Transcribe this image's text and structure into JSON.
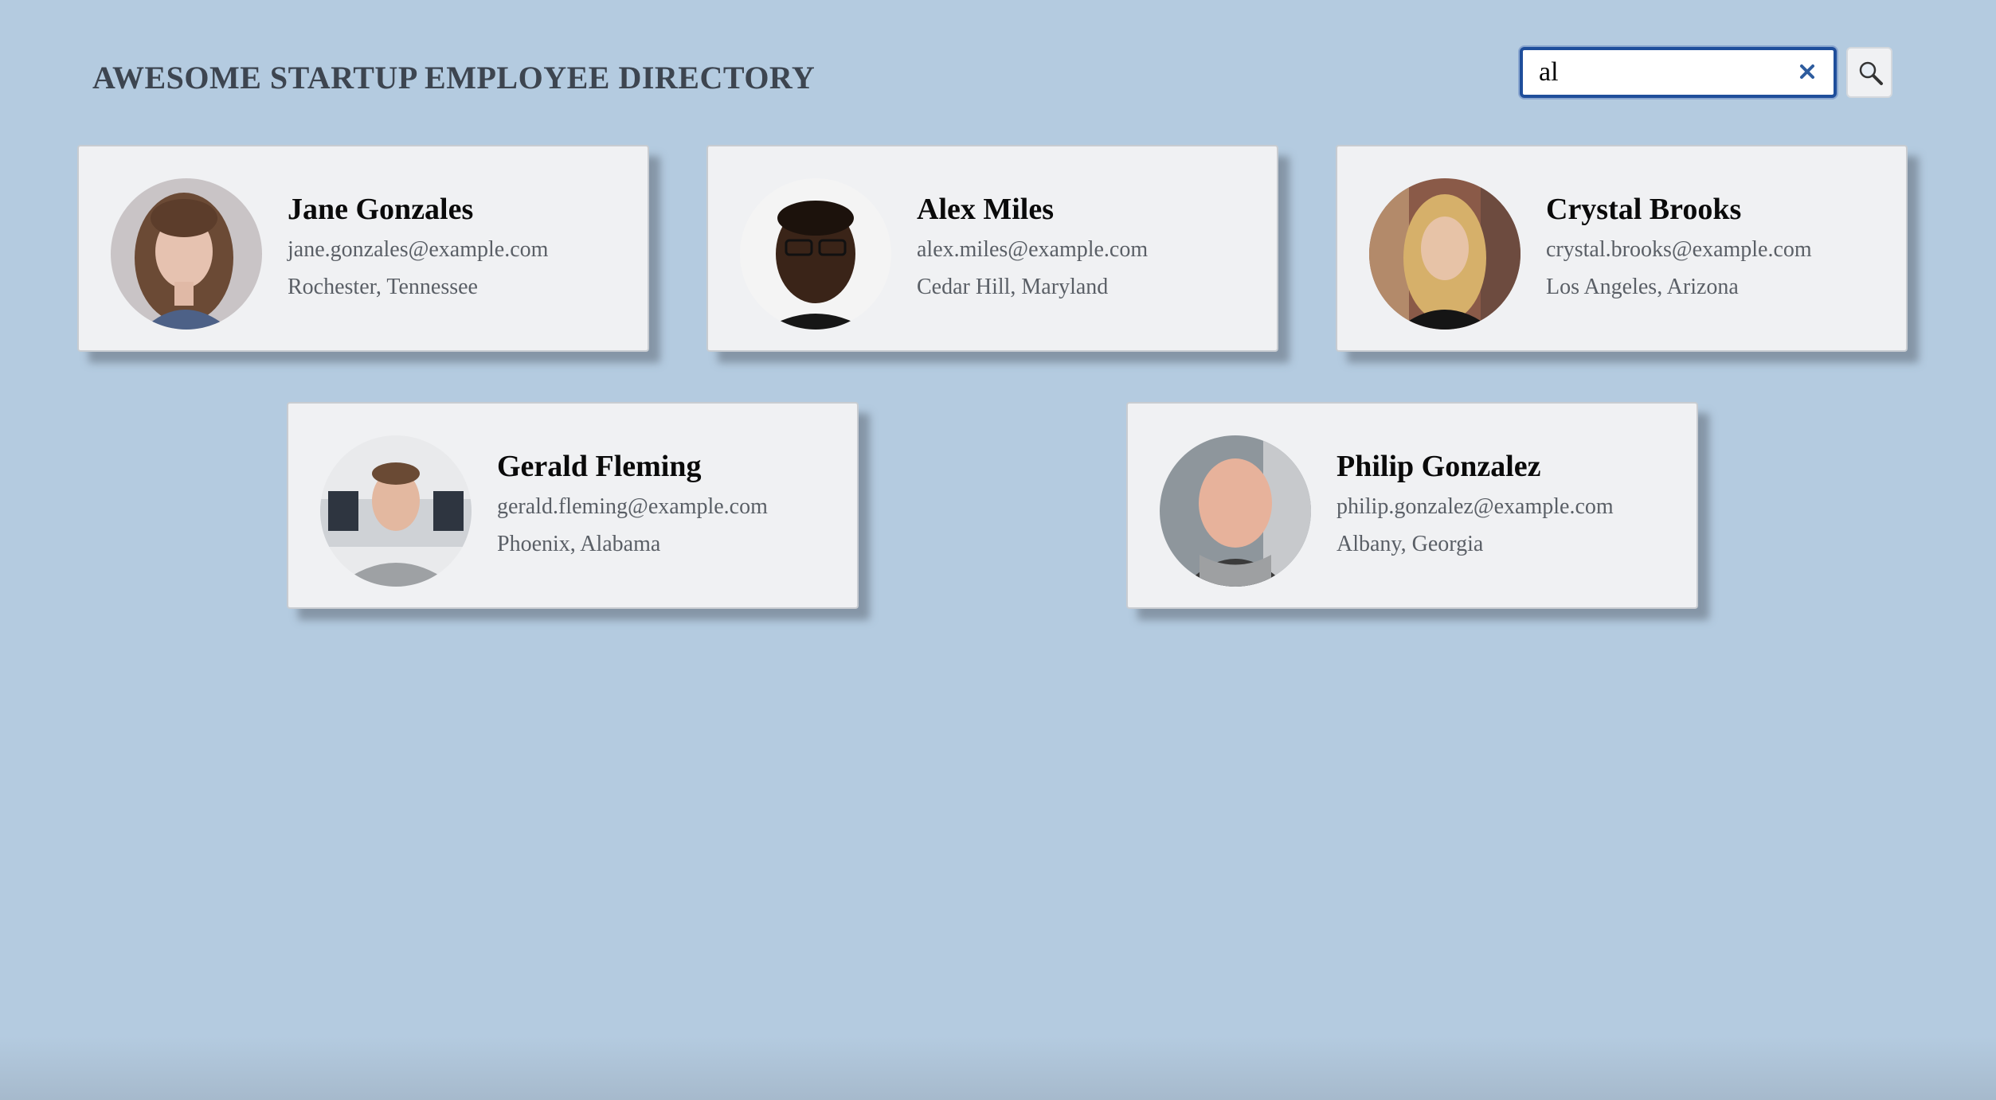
{
  "header": {
    "title": "AWESOME STARTUP EMPLOYEE DIRECTORY"
  },
  "search": {
    "value": "al",
    "clear_icon": "close-icon",
    "button_icon": "search-icon"
  },
  "colors": {
    "background": "#b4cbe0",
    "card": "#f0f1f3",
    "search_border": "#1f4e9b",
    "title": "#3d4550"
  },
  "employees": [
    {
      "name": "Jane Gonzales",
      "email": "jane.gonzales@example.com",
      "location": "Rochester, Tennessee"
    },
    {
      "name": "Alex Miles",
      "email": "alex.miles@example.com",
      "location": "Cedar Hill, Maryland"
    },
    {
      "name": "Crystal Brooks",
      "email": "crystal.brooks@example.com",
      "location": "Los Angeles, Arizona"
    },
    {
      "name": "Gerald Fleming",
      "email": "gerald.fleming@example.com",
      "location": "Phoenix, Alabama"
    },
    {
      "name": "Philip Gonzalez",
      "email": "philip.gonzalez@example.com",
      "location": "Albany, Georgia"
    }
  ]
}
